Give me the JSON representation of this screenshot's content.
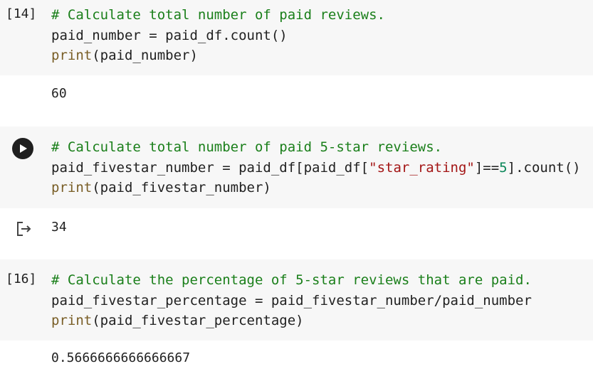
{
  "cells": [
    {
      "exec_count": "[14]",
      "code": [
        {
          "tokens": [
            {
              "t": "# Calculate total number of paid reviews.",
              "c": "comment"
            }
          ]
        },
        {
          "tokens": [
            {
              "t": "paid_number = paid_df.count()",
              "c": ""
            }
          ]
        },
        {
          "tokens": [
            {
              "t": "print",
              "c": "builtin"
            },
            {
              "t": "(paid_number)",
              "c": ""
            }
          ]
        }
      ],
      "output": "60"
    },
    {
      "exec_count": "",
      "run_icon": "play-icon",
      "code": [
        {
          "tokens": [
            {
              "t": "# Calculate total number of paid 5-star reviews.",
              "c": "comment"
            }
          ]
        },
        {
          "tokens": [
            {
              "t": "paid_fivestar_number = paid_df[paid_df[",
              "c": ""
            },
            {
              "t": "\"star_rating\"",
              "c": "string"
            },
            {
              "t": "]==",
              "c": ""
            },
            {
              "t": "5",
              "c": "number"
            },
            {
              "t": "].count()",
              "c": ""
            }
          ]
        },
        {
          "tokens": [
            {
              "t": "print",
              "c": "builtin"
            },
            {
              "t": "(paid_fivestar_number)",
              "c": ""
            }
          ]
        }
      ],
      "output_icon": "output-arrow-icon",
      "output": "34"
    },
    {
      "exec_count": "[16]",
      "code": [
        {
          "tokens": [
            {
              "t": "# Calculate the percentage of 5-star reviews that are paid.",
              "c": "comment"
            }
          ]
        },
        {
          "tokens": [
            {
              "t": "paid_fivestar_percentage = paid_fivestar_number/paid_number",
              "c": ""
            }
          ]
        },
        {
          "tokens": [
            {
              "t": "print",
              "c": "builtin"
            },
            {
              "t": "(paid_fivestar_percentage)",
              "c": ""
            }
          ]
        }
      ],
      "output": "0.5666666666666667"
    }
  ]
}
